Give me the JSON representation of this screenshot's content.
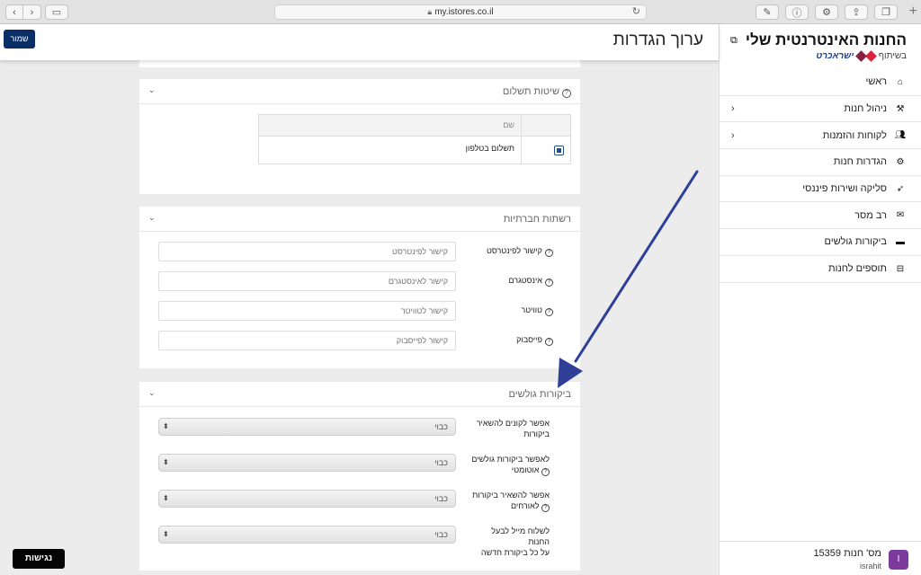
{
  "browser": {
    "url": "my.istores.co.il"
  },
  "header": {
    "title": "ערוך הגדרות",
    "save_label": "שמור"
  },
  "sidebar": {
    "brand_title": "החנות האינטרנטית שלי",
    "brand_with": "בשיתוף",
    "brand_partner": "ישראכרט",
    "items": [
      {
        "label": "ראשי",
        "icon": "home-icon"
      },
      {
        "label": "ניהול חנות",
        "icon": "tools-icon"
      },
      {
        "label": "לקוחות והזמנות",
        "icon": "users-icon"
      },
      {
        "label": "הגדרות חנות",
        "icon": "gear-icon"
      },
      {
        "label": "סליקה ושירות פיננסי",
        "icon": "rocket-icon"
      },
      {
        "label": "רב מסר",
        "icon": "envelope-icon"
      },
      {
        "label": "ביקורות גולשים",
        "icon": "comment-icon"
      },
      {
        "label": "תוספים לחנות",
        "icon": "store-icon"
      }
    ],
    "store_number": "מס' חנות 15359",
    "store_user": "israhit",
    "store_avatar": "I"
  },
  "payment_panel": {
    "title": "שיטות תשלום",
    "col_name": "שם",
    "rows": [
      {
        "name": "תשלום בטלפון",
        "checked": true
      }
    ]
  },
  "social_panel": {
    "title": "רשתות חברתיות",
    "fields": [
      {
        "label": "קישור לפינטרסט",
        "placeholder": "קישור לפינטרסט"
      },
      {
        "label": "אינסטגרם",
        "placeholder": "קישור לאינסטגרם"
      },
      {
        "label": "טוויטר",
        "placeholder": "קישור לטוויטר"
      },
      {
        "label": "פייסבוק",
        "placeholder": "קישור לפייסבוק"
      }
    ]
  },
  "reviews_panel": {
    "title": "ביקורות גולשים",
    "settings": [
      {
        "label_1": "אפשר לקונים להשאיר",
        "label_2": "ביקורות",
        "value": "כבוי"
      },
      {
        "label_1": "לאפשר ביקורות גולשים",
        "label_2": "אוטומטי",
        "value": "כבוי"
      },
      {
        "label_1": "אפשר להשאיר ביקורות",
        "label_2": "לאורחים",
        "value": "כבוי"
      },
      {
        "label_1": "לשלוח מייל לבעל החנות",
        "label_2": "על כל ביקורת חדשה",
        "value": "כבוי"
      }
    ]
  },
  "accessibility_label": "נגישות",
  "colors": {
    "primary": "#0a2f66",
    "annotation_arrow": "#2f3f98",
    "avatar": "#7c3a9c"
  }
}
